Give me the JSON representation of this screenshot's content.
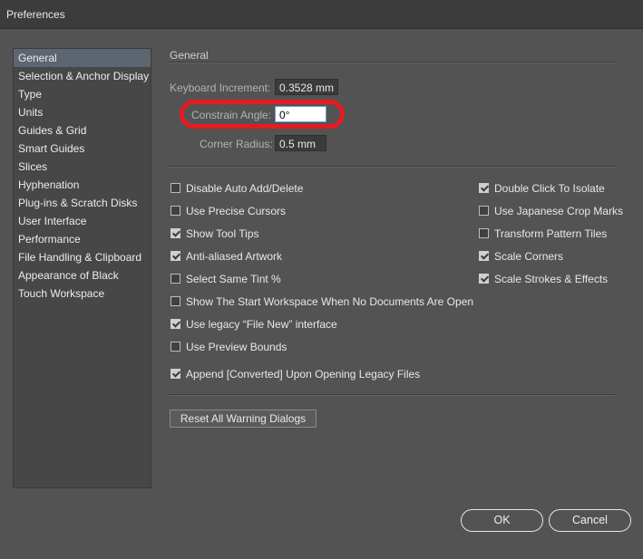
{
  "window": {
    "title": "Preferences"
  },
  "sidebar": {
    "items": [
      {
        "label": "General",
        "active": true
      },
      {
        "label": "Selection & Anchor Display"
      },
      {
        "label": "Type"
      },
      {
        "label": "Units"
      },
      {
        "label": "Guides & Grid"
      },
      {
        "label": "Smart Guides"
      },
      {
        "label": "Slices"
      },
      {
        "label": "Hyphenation"
      },
      {
        "label": "Plug-ins & Scratch Disks"
      },
      {
        "label": "User Interface"
      },
      {
        "label": "Performance"
      },
      {
        "label": "File Handling & Clipboard"
      },
      {
        "label": "Appearance of Black"
      },
      {
        "label": "Touch Workspace"
      }
    ]
  },
  "general": {
    "section_title": "General",
    "keyboard_increment": {
      "label": "Keyboard Increment:",
      "value": "0.3528 mm"
    },
    "constrain_angle": {
      "label": "Constrain Angle:",
      "value": "0°"
    },
    "corner_radius": {
      "label": "Corner Radius:",
      "value": "0.5 mm"
    },
    "checkboxes_left": [
      {
        "label": "Disable Auto Add/Delete",
        "checked": false
      },
      {
        "label": "Use Precise Cursors",
        "checked": false
      },
      {
        "label": "Show Tool Tips",
        "checked": true
      },
      {
        "label": "Anti-aliased Artwork",
        "checked": true
      },
      {
        "label": "Select Same Tint %",
        "checked": false
      },
      {
        "label": "Show The Start Workspace When No Documents Are Open",
        "checked": false
      },
      {
        "label": "Use legacy “File New” interface",
        "checked": true
      },
      {
        "label": "Use Preview Bounds",
        "checked": false
      },
      {
        "label": "Append [Converted] Upon Opening Legacy Files",
        "checked": true
      }
    ],
    "checkboxes_right": [
      {
        "label": "Double Click To Isolate",
        "checked": true
      },
      {
        "label": "Use Japanese Crop Marks",
        "checked": false
      },
      {
        "label": "Transform Pattern Tiles",
        "checked": false
      },
      {
        "label": "Scale Corners",
        "checked": true
      },
      {
        "label": "Scale Strokes & Effects",
        "checked": true
      }
    ],
    "reset_button": "Reset All Warning Dialogs"
  },
  "footer": {
    "ok": "OK",
    "cancel": "Cancel"
  },
  "colors": {
    "annotation": "#e31b23",
    "selection": "#5d6670"
  }
}
